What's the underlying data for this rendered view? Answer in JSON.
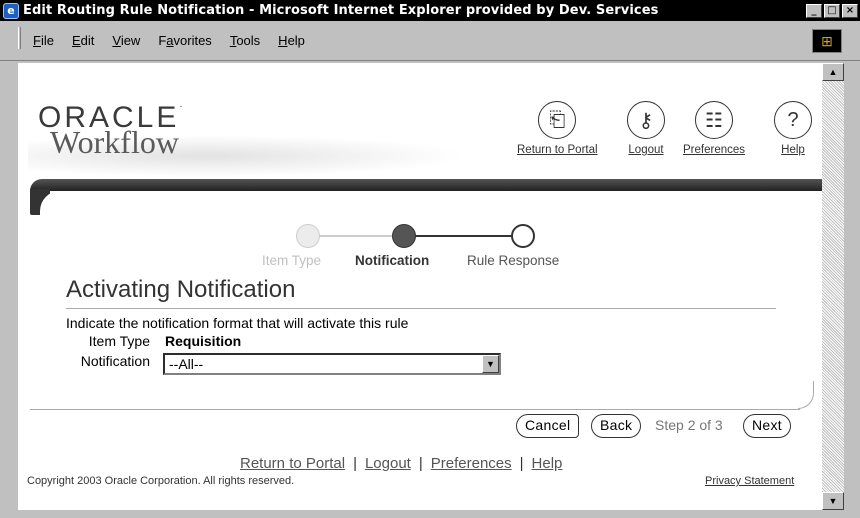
{
  "window": {
    "title": "Edit Routing Rule Notification - Microsoft Internet Explorer provided by Dev. Services",
    "controls": [
      "_",
      "□",
      "×"
    ]
  },
  "menu": {
    "items": [
      "File",
      "Edit",
      "View",
      "Favorites",
      "Tools",
      "Help"
    ],
    "underlined_letters": [
      "F",
      "E",
      "V",
      "a",
      "T",
      "H"
    ]
  },
  "branding": {
    "oracle": "ORACLE",
    "product": "Workflow"
  },
  "global_buttons": {
    "return_to_portal": "Return to Portal",
    "logout": "Logout",
    "preferences": "Preferences",
    "help": "Help"
  },
  "train": {
    "steps": [
      "Item Type",
      "Notification",
      "Rule Response"
    ],
    "current_index": 1
  },
  "page": {
    "title": "Activating Notification",
    "instruction": "Indicate the notification format that will activate this rule",
    "item_type_label": "Item Type",
    "item_type_value": "Requisition",
    "notification_label": "Notification",
    "notification_value": "--All--"
  },
  "actions": {
    "cancel": "Cancel",
    "back": "Back",
    "step_indicator": "Step 2 of 3",
    "next": "Next"
  },
  "footer": {
    "links": [
      "Return to Portal",
      "Logout",
      "Preferences",
      "Help"
    ],
    "copyright": "Copyright 2003 Oracle Corporation. All rights reserved.",
    "privacy": "Privacy Statement"
  },
  "colors": {
    "titlebar": "#000000",
    "chrome": "#c0c0c0",
    "header_bar": "#333333",
    "train_current": "#555555"
  }
}
